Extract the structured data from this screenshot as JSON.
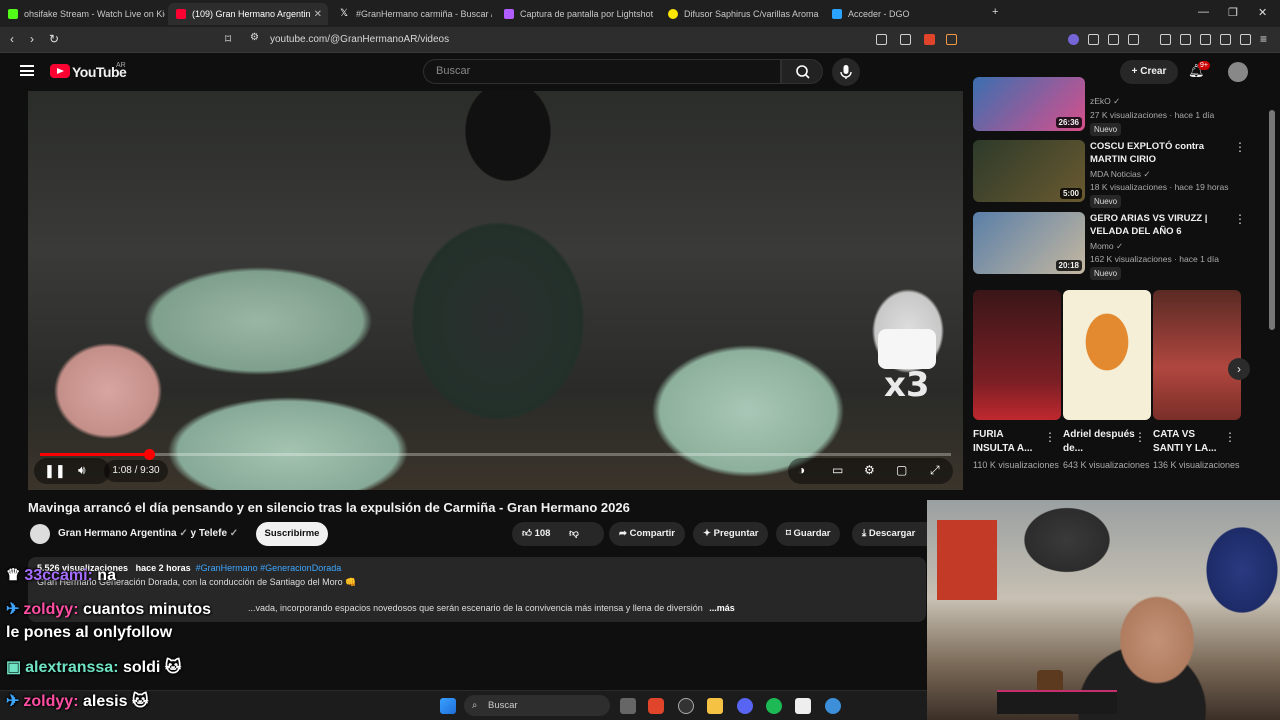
{
  "browser": {
    "tabs": [
      {
        "title": "ohsifake Stream - Watch Live on Kick",
        "fav": "#53fc18"
      },
      {
        "title": "(109) Gran Hermano Argentin",
        "fav": "#ff0033"
      },
      {
        "title": "#GranHermano carmiña - Buscar / X",
        "fav": "#ffffff"
      },
      {
        "title": "Captura de pantalla por Lightshot",
        "fav": "#b15cff"
      },
      {
        "title": "Difusor Saphirus C/varillas Aroma Ca",
        "fav": "#ffe600"
      },
      {
        "title": "Acceder - DGO",
        "fav": "#2aa3ff"
      }
    ],
    "url": "youtube.com/@GranHermanoAR/videos"
  },
  "youtube": {
    "logo_text": "YouTube",
    "country": "AR",
    "search_placeholder": "Buscar",
    "create_label": "Crear",
    "notif_count": "9+"
  },
  "player": {
    "time": "1:08 / 9:30",
    "progress": 0.12,
    "sticker_text": "x3"
  },
  "video": {
    "title": "Mavinga arrancó el día pensando y en silencio tras la expulsión de Carmiña - Gran Hermano 2026",
    "channel": "Gran Hermano Argentina",
    "collab": "y Telefe",
    "subscribe": "Suscribirme",
    "likes": "108",
    "share": "Compartir",
    "ask": "Preguntar",
    "save": "Guardar",
    "download": "Descargar",
    "desc_views": "5.526 visualizaciones",
    "desc_time": "hace 2 horas",
    "desc_tags": "#GranHermano #GeneracionDorada",
    "desc_line2": "Gran Hermano Generación Dorada, con la conducción de Santiago del Moro 👊",
    "desc_line3": "...vada, incorporando espacios novedosos que serán escenario de la convivencia más intensa y llena de diversión",
    "desc_more": "...más"
  },
  "sidebar": {
    "videos": [
      {
        "title": "",
        "channel": "zEkO",
        "meta": "27 K visualizaciones · hace 1 día",
        "duration": "26:36",
        "badge": "Nuevo",
        "thumb": "#3a6fb0"
      },
      {
        "title": "COSCU EXPLOTÓ contra MARTIN CIRIO",
        "channel": "MDA Noticias",
        "meta": "18 K visualizaciones · hace 19 horas",
        "duration": "5:00",
        "badge": "Nuevo",
        "thumb": "#2d3a2a"
      },
      {
        "title": "GERO ARIAS VS VIRUZZ | VELADA DEL AÑO 6",
        "channel": "Momo",
        "meta": "162 K visualizaciones · hace 1 día",
        "duration": "20:18",
        "badge": "Nuevo",
        "thumb": "#5a7fa8"
      }
    ],
    "shorts": [
      {
        "title": "FURIA INSULTA A...",
        "views": "110 K visualizaciones",
        "thumb": "#7a1f25"
      },
      {
        "title": "Adriel después de...",
        "views": "643 K visualizaciones",
        "thumb": "#f2e7c4"
      },
      {
        "title": "CATA VS SANTI Y LA...",
        "views": "136 K visualizaciones",
        "thumb": "#b0473f"
      }
    ]
  },
  "chat": [
    {
      "user": "33ccami:",
      "msg": "na",
      "cls": "purple",
      "icon": "👑"
    },
    {
      "user": "zoldyy:",
      "msg": "cuantos minutos",
      "cls": "pink",
      "icon": "✈"
    },
    {
      "user": "",
      "msg": "le pones al onlyfollow",
      "cls": "",
      "icon": ""
    },
    {
      "user": "alextranssa:",
      "msg": "soldi",
      "cls": "teal",
      "icon": "🟩"
    },
    {
      "user": "zoldyy:",
      "msg": "alesis",
      "cls": "pink",
      "icon": "✈"
    }
  ],
  "taskbar": {
    "search": "Buscar"
  }
}
